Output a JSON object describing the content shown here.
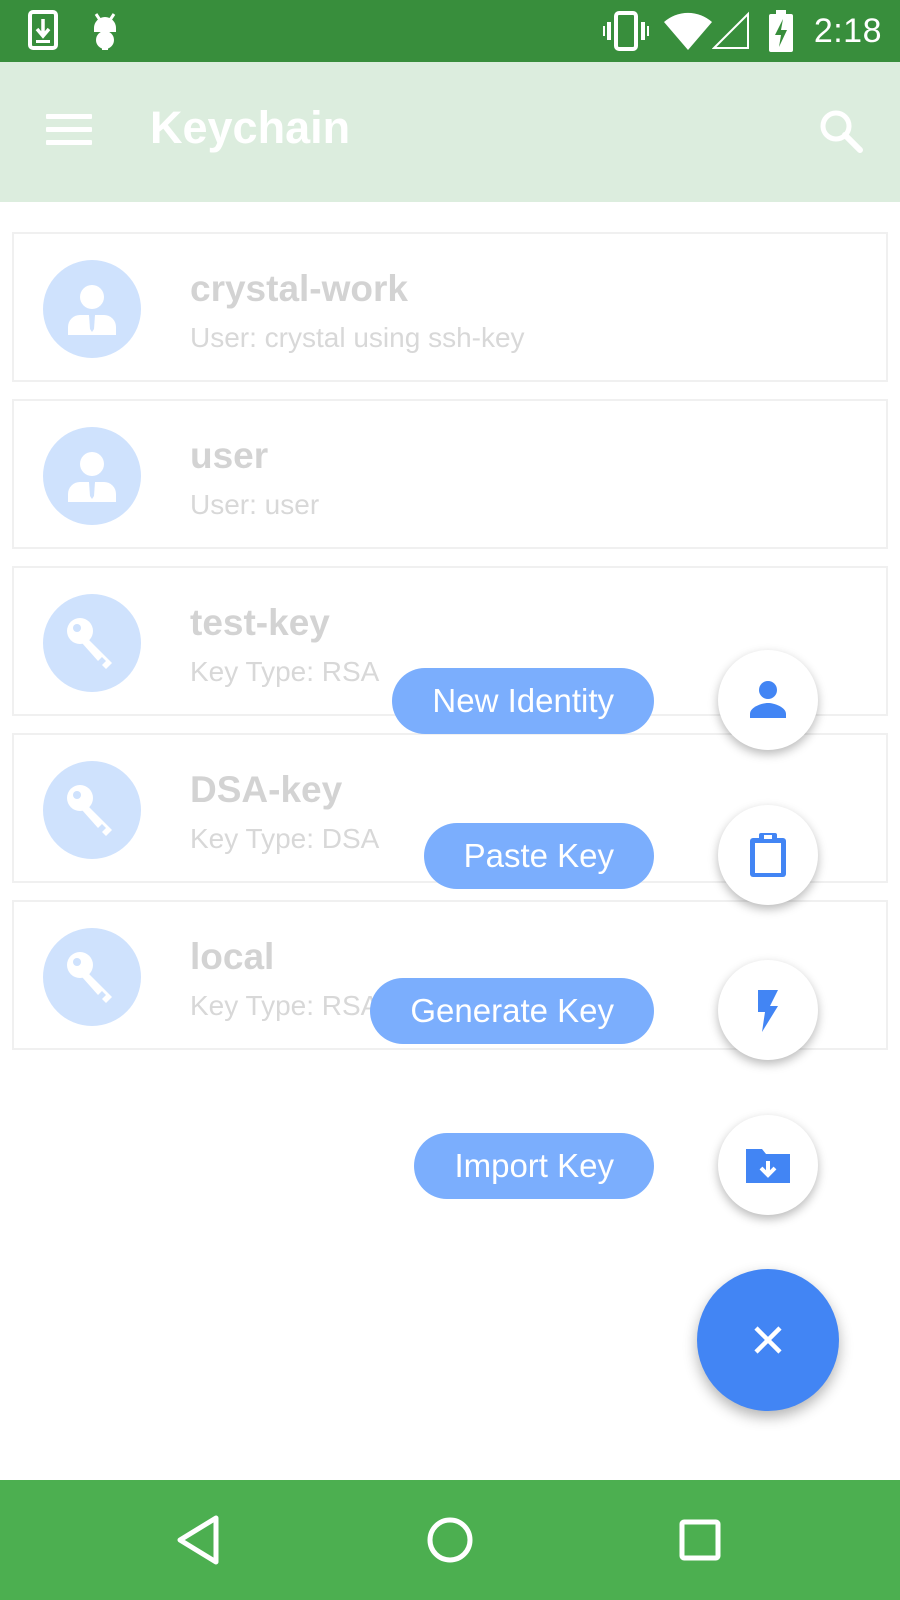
{
  "status_bar": {
    "time": "2:18",
    "icons": [
      "download-icon",
      "android-icon",
      "vibrate-icon",
      "wifi-icon",
      "signal-icon",
      "battery-charging-icon"
    ],
    "background": "#388e3c"
  },
  "app_bar": {
    "title": "Keychain",
    "icons": [
      "menu-icon",
      "search-icon"
    ],
    "background": "#dcedde"
  },
  "list": {
    "items": [
      {
        "title": "crystal-work",
        "subtitle": "User: crystal using ssh-key",
        "icon": "identity-icon"
      },
      {
        "title": "user",
        "subtitle": "User: user",
        "icon": "identity-icon"
      },
      {
        "title": "test-key",
        "subtitle": "Key Type: RSA",
        "icon": "key-icon"
      },
      {
        "title": "DSA-key",
        "subtitle": "Key Type: DSA",
        "icon": "key-icon"
      },
      {
        "title": "local",
        "subtitle": "Key Type: RSA",
        "icon": "key-icon"
      }
    ]
  },
  "speed_dial": {
    "actions": [
      {
        "label": "New Identity",
        "icon": "person-icon"
      },
      {
        "label": "Paste Key",
        "icon": "clipboard-icon"
      },
      {
        "label": "Generate Key",
        "icon": "lightning-icon"
      },
      {
        "label": "Import Key",
        "icon": "folder-download-icon"
      }
    ],
    "main_fab_icon": "close-icon",
    "accent": "#4285f4",
    "label_color": "#7baefd"
  },
  "nav_bar": {
    "icons": [
      "back-icon",
      "home-icon",
      "recents-icon"
    ],
    "background": "#4caf50"
  }
}
